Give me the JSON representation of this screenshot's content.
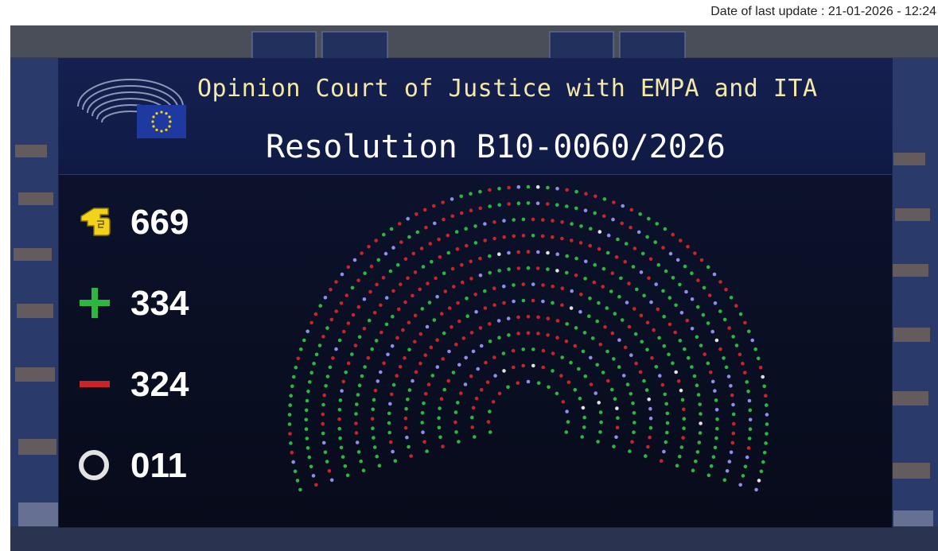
{
  "update": {
    "text": "Date of last update : 21-01-2026 - 12:24"
  },
  "board": {
    "title": "Opinion Court of Justice with EMPA and ITA",
    "subtitle": "Resolution B10-0060/2026"
  },
  "stats": {
    "total": "669",
    "for": "334",
    "against": "324",
    "abstain": "011"
  },
  "icons": {
    "total": "vote-hand-icon",
    "for": "plus-icon",
    "against": "minus-icon",
    "abstain": "circle-icon",
    "logo": "eu-parliament-logo"
  },
  "colors": {
    "for": "#2fb640",
    "against": "#c8242a",
    "abstain": "#e2e2e2",
    "absent": "#8f8ee8",
    "title": "#f3e9a8",
    "eu_blue": "#1e3aa0",
    "eu_star": "#ffd400"
  },
  "hemicycle": {
    "rows": 13,
    "seats": 705
  }
}
